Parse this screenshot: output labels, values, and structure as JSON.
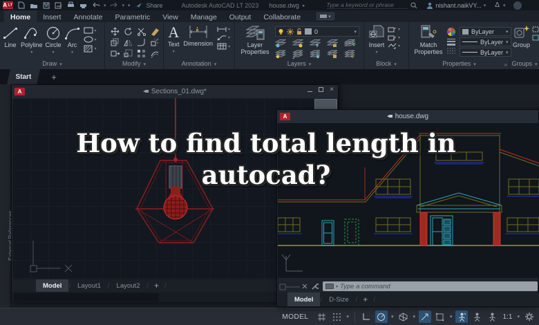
{
  "titlebar": {
    "badge": "A",
    "badge_lt": "LT",
    "share": "Share",
    "app_title": "Autodesk AutoCAD LT 2023",
    "doc_name": "house.dwg",
    "search_placeholder": "Type a keyword or phrase",
    "user": "nishant.naikVY..."
  },
  "ribbon": {
    "tabs": [
      "Home",
      "Insert",
      "Annotate",
      "Parametric",
      "View",
      "Manage",
      "Output",
      "Collaborate"
    ],
    "draw": {
      "label": "Draw",
      "tools": [
        "Line",
        "Polyline",
        "Circle",
        "Arc"
      ]
    },
    "modify": {
      "label": "Modify"
    },
    "annotation": {
      "label": "Annotation",
      "text_tool": "Text",
      "dimension_tool": "Dimension"
    },
    "layers": {
      "label": "Layers",
      "layer_properties": "Layer Properties",
      "current_layer": "0"
    },
    "block": {
      "label": "Block",
      "insert_tool": "Insert"
    },
    "properties": {
      "label": "Properties",
      "match_tool": "Match Properties",
      "object_color": "ByLayer",
      "lineweight": "ByLayer",
      "linetype": "ByLayer"
    },
    "groups": {
      "label": "Groups",
      "group_tool": "Group"
    }
  },
  "file_tabs": {
    "start": "Start"
  },
  "sidebar": {
    "label": "External References"
  },
  "sections_window": {
    "badge": "A",
    "title": "Sections_01.dwg*",
    "tabs": [
      "Model",
      "Layout1",
      "Layout2"
    ]
  },
  "house_window": {
    "badge": "A",
    "title": "house.dwg",
    "tabs": [
      "Model",
      "D-Size"
    ],
    "command_placeholder": "Type a command"
  },
  "overlay": {
    "line1": "How to find total length in",
    "line2": "autocad?"
  },
  "statusbar": {
    "model": "MODEL",
    "scale": "1:1"
  },
  "colors": {
    "accent_red": "#b3212f",
    "blue_highlight": "#2f5273",
    "canvas": "#13171f"
  }
}
